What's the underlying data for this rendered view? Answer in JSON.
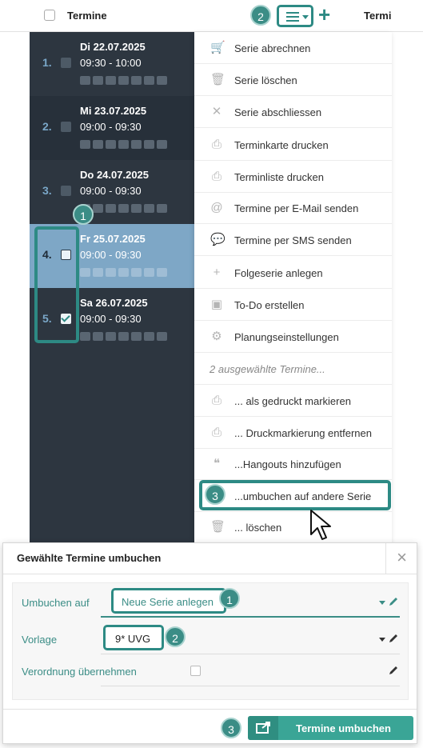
{
  "header": {
    "title": "Termine",
    "title_right": "Termi",
    "plus_label": "+"
  },
  "badges": {
    "menu": "2",
    "selection": "1",
    "umbuchen": "3",
    "field_umbuchen": "1",
    "field_vorlage": "2",
    "submit": "3"
  },
  "appointments": [
    {
      "num": "1.",
      "date": "Di 22.07.2025",
      "time": "09:30 - 10:00",
      "checked": false
    },
    {
      "num": "2.",
      "date": "Mi 23.07.2025",
      "time": "09:00 - 09:30",
      "checked": false
    },
    {
      "num": "3.",
      "date": "Do 24.07.2025",
      "time": "09:00 - 09:30",
      "checked": false
    },
    {
      "num": "4.",
      "date": "Fr 25.07.2025",
      "time": "09:00 - 09:30",
      "checked": false
    },
    {
      "num": "5.",
      "date": "Sa 26.07.2025",
      "time": "09:00 - 09:30",
      "checked": true
    }
  ],
  "menu": {
    "items": [
      {
        "icon": "cart-icon",
        "label": "Serie abrechnen"
      },
      {
        "icon": "trash-icon",
        "label": "Serie löschen"
      },
      {
        "icon": "close-icon",
        "label": "Serie abschliessen"
      },
      {
        "icon": "print-icon",
        "label": "Terminkarte drucken"
      },
      {
        "icon": "print-icon",
        "label": "Terminliste drucken"
      },
      {
        "icon": "at-icon",
        "label": "Termine per E-Mail senden"
      },
      {
        "icon": "sms-icon",
        "label": "Termine per SMS senden"
      },
      {
        "icon": "plus-icon",
        "label": "Folgeserie anlegen"
      },
      {
        "icon": "todo-icon",
        "label": "To-Do erstellen"
      },
      {
        "icon": "gear-icon",
        "label": "Planungseinstellungen"
      }
    ],
    "section_label": "2 ausgewählte Termine...",
    "selection_items": [
      {
        "icon": "print-icon",
        "label": "... als gedruckt markieren"
      },
      {
        "icon": "print-icon",
        "label": "... Druckmarkierung entfernen"
      },
      {
        "icon": "hangouts-icon",
        "label": "...Hangouts hinzufügen"
      },
      {
        "icon": "",
        "label": "...umbuchen auf andere Serie"
      },
      {
        "icon": "trash-icon",
        "label": "... löschen"
      }
    ]
  },
  "dialog": {
    "title": "Gewählte Termine umbuchen",
    "close": "×",
    "fields": {
      "umbuchen_label": "Umbuchen auf",
      "umbuchen_value": "Neue Serie anlegen",
      "vorlage_label": "Vorlage",
      "vorlage_value": "9* UVG",
      "verordnung_label": "Verordnung übernehmen"
    },
    "submit_label": "Termine umbuchen"
  },
  "colors": {
    "accent": "#2d8a84",
    "list_bg": "#2d3640",
    "selected_row": "#7ea7c6",
    "button": "#3aa596"
  }
}
